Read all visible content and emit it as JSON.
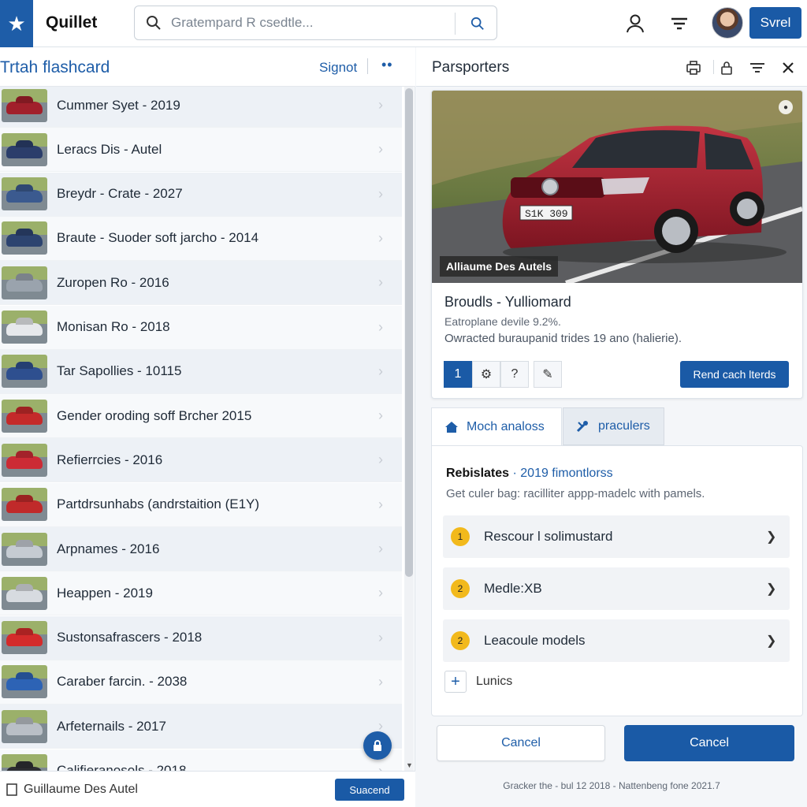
{
  "app": {
    "name": "Quillet"
  },
  "search": {
    "placeholder": "Gratempard R csedtle..."
  },
  "topbar": {
    "action_label": "Svrel"
  },
  "left": {
    "title": "Trtah flashcard",
    "link": "Signot",
    "more": "••",
    "items": [
      {
        "label": "Cummer Syet - 2019",
        "color": "#a1202b"
      },
      {
        "label": "Leracs Dis - Autel",
        "color": "#2b3e6b"
      },
      {
        "label": "Breydr - Crate - 2027",
        "color": "#3b5a8f"
      },
      {
        "label": "Braute - Suoder soft jarcho - 2014",
        "color": "#2d4470"
      },
      {
        "label": "Zuropen Ro - 2016",
        "color": "#9aa3ad"
      },
      {
        "label": "Monisan Ro - 2018",
        "color": "#e6e8eb"
      },
      {
        "label": "Tar Sapollies - 10115",
        "color": "#2e4f8f"
      },
      {
        "label": "Gender oroding soff Brcher 2015",
        "color": "#c42a2a"
      },
      {
        "label": "Refierrcies - 2016",
        "color": "#cc2b35"
      },
      {
        "label": "Partdrsunhabs (andrstaition (E1Y)",
        "color": "#c02a2a"
      },
      {
        "label": "Arpnames - 2016",
        "color": "#c5cbd2"
      },
      {
        "label": "Heappen - 2019",
        "color": "#d7dbe0"
      },
      {
        "label": "Sustonsafrascers - 2018",
        "color": "#d42b2b"
      },
      {
        "label": "Caraber farcin. - 2038",
        "color": "#2d63b5"
      },
      {
        "label": "Arfeternails - 2017",
        "color": "#b9bfc6"
      },
      {
        "label": "Califieranosols - 2018",
        "color": "#2e2f33"
      }
    ],
    "footer_text": "Guillaume Des Autel",
    "footer_button": "Suacend"
  },
  "right": {
    "title": "Parsporters",
    "card": {
      "image_caption": "Alliaume Des Autels",
      "plate": "S1K 309",
      "title": "Broudls - Yulliomard",
      "subtitle": "Eatroplane devile 9.2%.",
      "description": "Owracted buraupanid trides 19 ano (halierie).",
      "tools": [
        "1",
        "⚙",
        "?",
        "✎"
      ],
      "button": "Rend cach lterds"
    },
    "tabs": [
      {
        "label": "Moch analoss",
        "icon": "home-icon"
      },
      {
        "label": "praculers",
        "icon": "tools-icon"
      }
    ],
    "panel": {
      "heading_bold": "Rebislates",
      "heading_rest": " · 2019 fimontlorss",
      "description": "Get culer bag: racilliter appp-madelc with pamels.",
      "options": [
        {
          "badge": "1",
          "label": "Rescour l solimustard"
        },
        {
          "badge": "2",
          "label": "Medle:XB"
        },
        {
          "badge": "2",
          "label": "Leacoule models"
        }
      ],
      "add_label": "Lunics"
    },
    "cancel_secondary": "Cancel",
    "cancel_primary": "Cancel",
    "footer": "Gracker the - bul 12 2018 - Nattenbeng fone 2021.7"
  },
  "colors": {
    "accent": "#1a5aa6",
    "badge": "#f2b91c",
    "car": "#a51f2c"
  }
}
